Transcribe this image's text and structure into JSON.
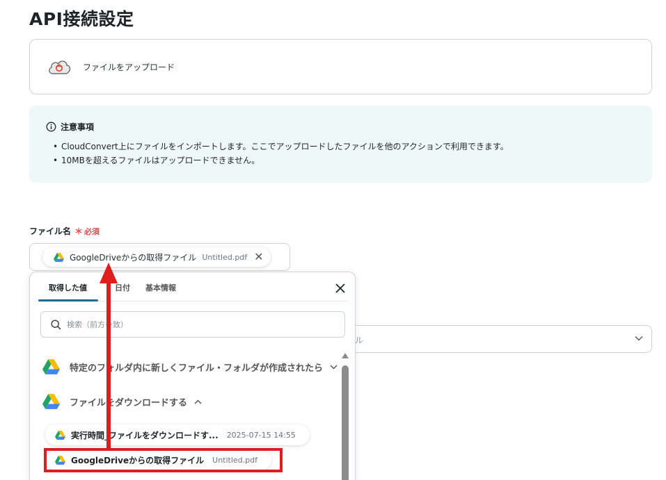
{
  "page": {
    "title": "API接続設定"
  },
  "action": {
    "label": "ファイルをアップロード",
    "icon": "cloud-upload-icon"
  },
  "notice": {
    "heading": "注意事項",
    "items": [
      "CloudConvert上にファイルをインポートします。ここでアップロードしたファイルを他のアクションで利用できます。",
      "10MBを超えるファイルはアップロードできません。"
    ]
  },
  "field": {
    "label": "ファイル名",
    "required_mark": "＊",
    "required_text": "必須",
    "chip_label": "GoogleDriveからの取得ファイル",
    "chip_sub": "Untitled.pdf"
  },
  "background_select": {
    "partial_text": "ル"
  },
  "popup": {
    "tabs": [
      "取得した値",
      "日付",
      "基本情報"
    ],
    "search_placeholder": "検索（前方一致）",
    "groups": [
      {
        "label": "特定のフォルダ内に新しくファイル・フォルダが作成されたら",
        "expanded": false
      },
      {
        "label": "ファイルをダウンロードする",
        "expanded": true
      }
    ],
    "items": [
      {
        "label": "実行時間_ファイルをダウンロードす...",
        "sub": "2025-07-15 14:55"
      },
      {
        "label": "GoogleDriveからの取得ファイル",
        "sub": "Untitled.pdf"
      }
    ]
  },
  "colors": {
    "accent": "#1b6e8f",
    "annotation_red": "#e01c1c",
    "notice_bg": "#eef9f7",
    "required": "#e5484d"
  }
}
